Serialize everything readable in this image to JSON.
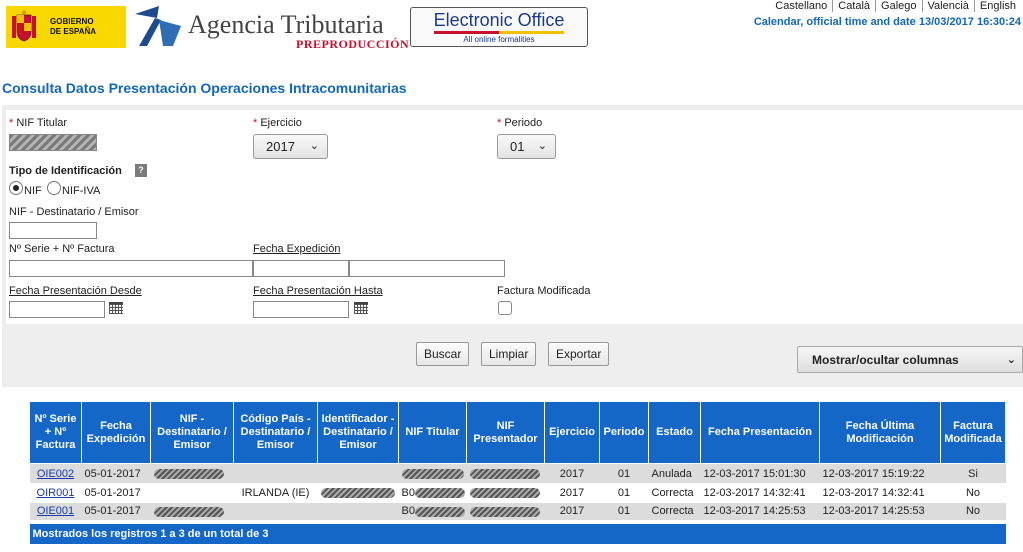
{
  "header": {
    "gobierno": "GOBIERNO\nDE ESPAÑA",
    "agency": "Agencia Tributaria",
    "environment": "PREPRODUCCIÓN",
    "eoffice_title": "Electronic Office",
    "eoffice_sub": "All online formalities",
    "languages": [
      "Castellano",
      "Català",
      "Galego",
      "Valencià",
      "English"
    ],
    "calendar": "Calendar, official time and date 13/03/2017 16:30:24"
  },
  "page": {
    "title": "Consulta Datos Presentación Operaciones Intracomunitarias"
  },
  "form": {
    "required_mark": "*",
    "nif_titular_label": "NIF Titular",
    "ejercicio_label": "Ejercicio",
    "ejercicio_value": "2017",
    "periodo_label": "Periodo",
    "periodo_value": "01",
    "tipo_id_label": "Tipo de Identificación",
    "help_symbol": "?",
    "radio_nif": "NIF",
    "radio_nif_iva": "NIF-IVA",
    "nif_dest_label": "NIF - Destinatario / Emisor",
    "serie_label": "Nº Serie + Nº Factura",
    "fecha_exp_label": "Fecha Expedición",
    "fecha_desde_label": "Fecha Presentación Desde",
    "fecha_hasta_label": "Fecha Presentación Hasta",
    "factura_mod_label": "Factura Modificada"
  },
  "buttons": {
    "buscar": "Buscar",
    "limpiar": "Limpiar",
    "exportar": "Exportar",
    "columns": "Mostrar/ocultar columnas"
  },
  "table": {
    "headers": [
      "Nº Serie + Nº Factura",
      "Fecha Expedición",
      "NIF - Destinatario / Emisor",
      "Código País - Destinatario / Emisor",
      "Identificador - Destinatario / Emisor",
      "NIF Titular",
      "NIF Presentador",
      "Ejercicio",
      "Periodo",
      "Estado",
      "Fecha Presentación",
      "Fecha Última Modificación",
      "Factura Modificada"
    ],
    "rows": [
      {
        "serie": "OIE002",
        "fecha_exp": "05-01-2017",
        "pais": "",
        "nif_titular_prefix": "",
        "ejercicio": "2017",
        "periodo": "01",
        "estado": "Anulada",
        "fecha_pres": "12-03-2017 15:01:30",
        "fecha_mod": "12-03-2017 15:19:22",
        "modificada": "Si"
      },
      {
        "serie": "OIR001",
        "fecha_exp": "05-01-2017",
        "pais": "IRLANDA (IE)",
        "nif_titular_prefix": "B0",
        "ejercicio": "2017",
        "periodo": "01",
        "estado": "Correcta",
        "fecha_pres": "12-03-2017 14:32:41",
        "fecha_mod": "12-03-2017 14:32:41",
        "modificada": "No"
      },
      {
        "serie": "OIE001",
        "fecha_exp": "05-01-2017",
        "pais": "",
        "nif_titular_prefix": "B0",
        "ejercicio": "2017",
        "periodo": "01",
        "estado": "Correcta",
        "fecha_pres": "12-03-2017 14:25:53",
        "fecha_mod": "12-03-2017 14:25:53",
        "modificada": "No"
      }
    ],
    "footer": "Mostrados los registros 1 a 3 de un total de 3"
  }
}
